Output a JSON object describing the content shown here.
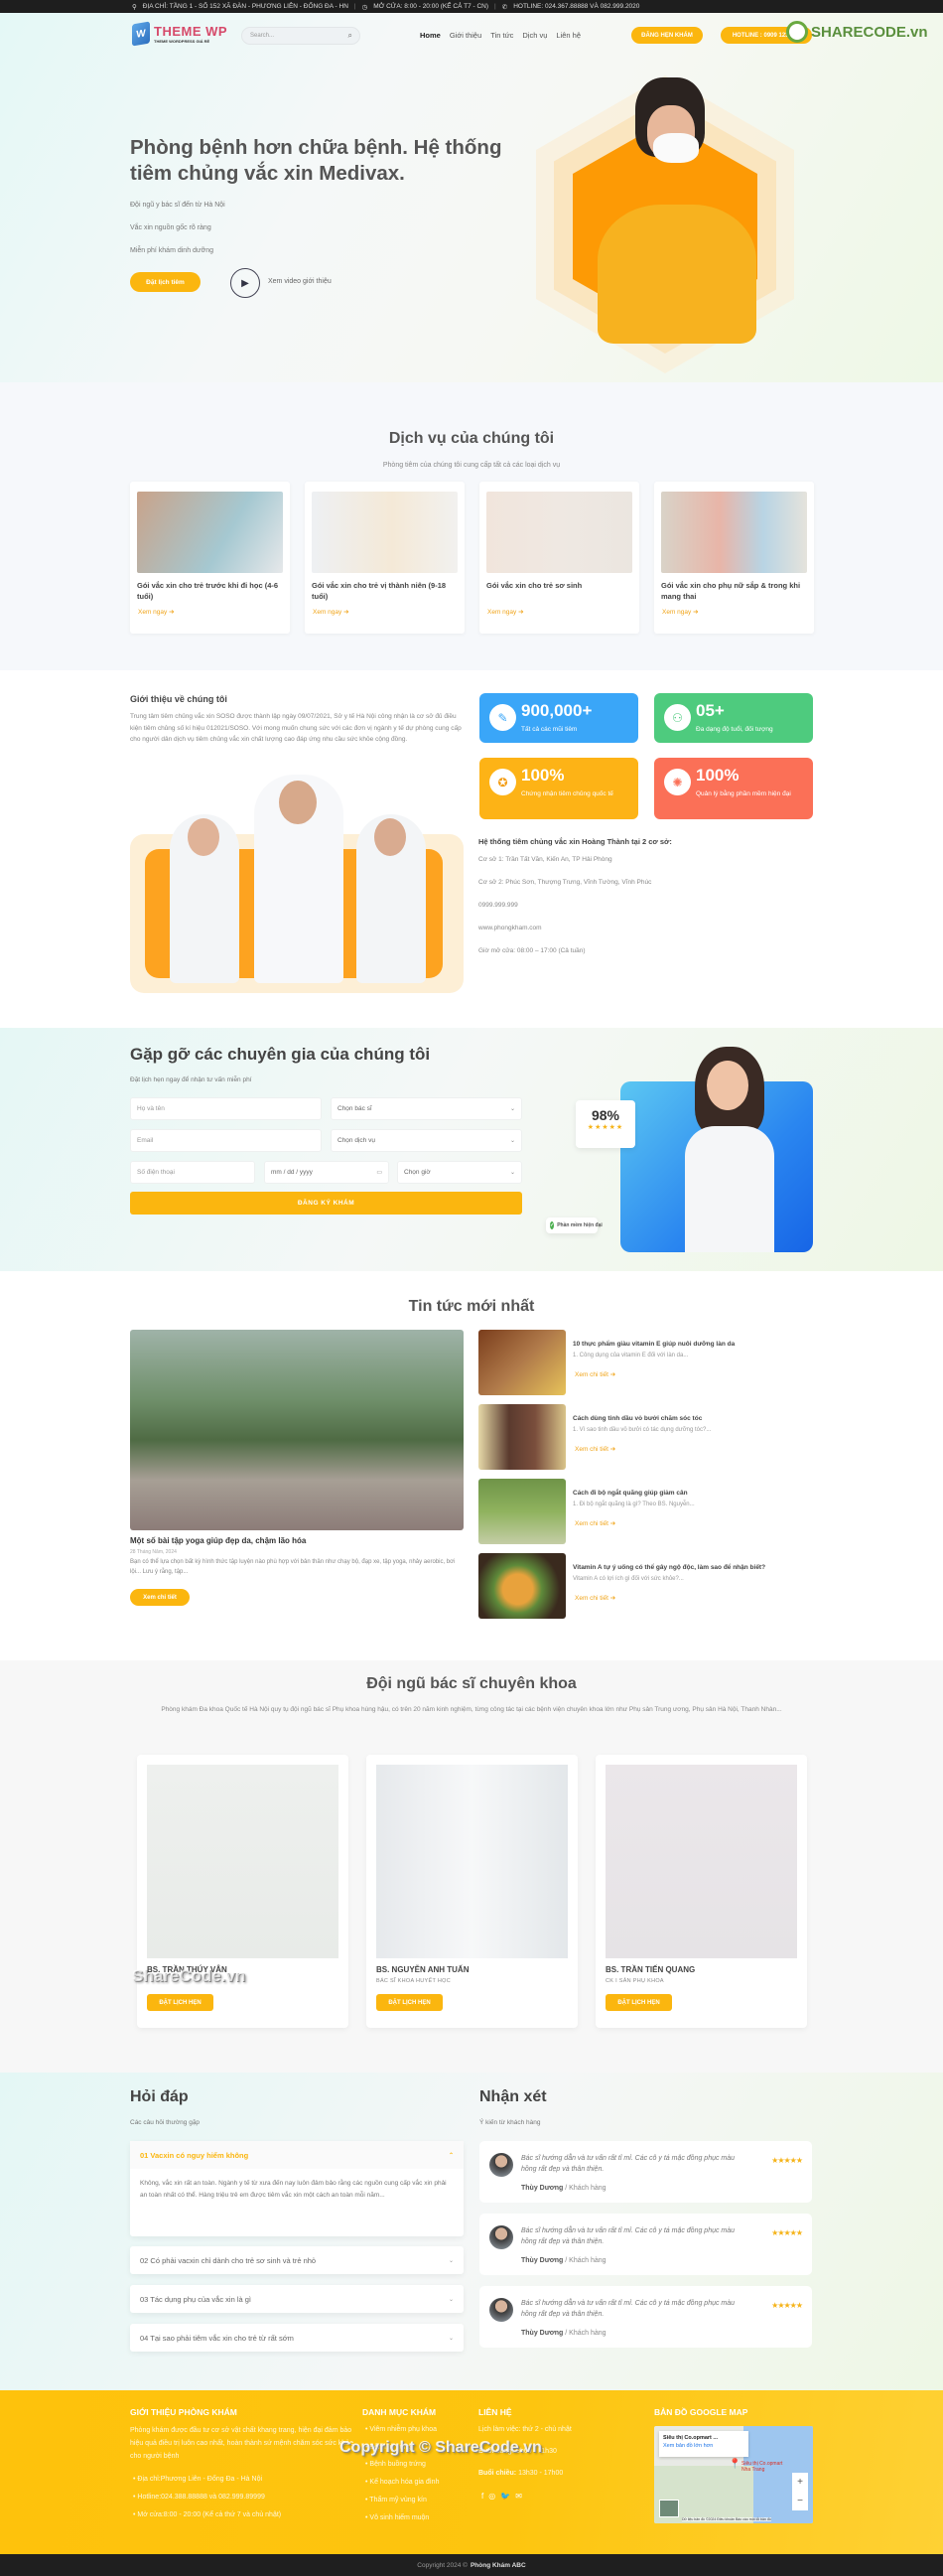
{
  "topbar": {
    "address": "ĐỊA CHỈ: TẦNG 1 - SỐ 152 XÃ ĐÀN - PHƯƠNG LIÊN - ĐỐNG ĐA - HN",
    "hours": "MỞ CỬA: 8:00 - 20:00 (KỂ CẢ T7 - CN)",
    "hotline": "HOTLINE: 024.367.88888 VÀ 082.999.2020"
  },
  "header": {
    "logo_title": "THEME WP",
    "logo_sub": "THEME WORDPRESS GIÁ RẺ",
    "search_placeholder": "Search...",
    "nav": [
      "Home",
      "Giới thiệu",
      "Tin tức",
      "Dịch vụ",
      "Liên hệ"
    ],
    "book_button": "ĐĂNG HẸN KHÁM",
    "hotline_button": "HOTLINE : 0909 123 456",
    "watermark": "SHARECODE.vn"
  },
  "hero": {
    "title": "Phòng bệnh hơn chữa bệnh. Hệ thống tiêm chủng vắc xin Medivax.",
    "features": [
      "Đội ngũ y bác sĩ đến từ Hà Nội",
      "Vắc xin nguồn gốc rõ ràng",
      "Miễn phí khám dinh dưỡng"
    ],
    "cta": "Đặt lịch tiêm",
    "video_label": "Xem video giới thiệu"
  },
  "services": {
    "title": "Dịch vụ của chúng tôi",
    "subtitle": "Phòng tiêm của chúng tôi cung cấp tất cả các loại dịch vụ",
    "items": [
      {
        "title": "Gói vắc xin cho trẻ trước khi đi học (4-6 tuổi)",
        "link": "Xem ngay"
      },
      {
        "title": "Gói vắc xin cho trẻ vị thành niên (9-18 tuổi)",
        "link": "Xem ngay"
      },
      {
        "title": "Gói vắc xin cho trẻ sơ sinh",
        "link": "Xem ngay"
      },
      {
        "title": "Gói vắc xin cho phụ nữ sắp & trong khi mang thai",
        "link": "Xem ngay"
      }
    ]
  },
  "about": {
    "title": "Giới thiệu về chúng tôi",
    "text": "Trung tâm tiêm chủng vắc xin SOSO được thành lập ngày 09/07/2021, Sở y tế Hà Nội công nhận là cơ sở đủ điều kiện tiêm chủng số kí hiệu 012021/SOSO. Với mong muốn chung sức với các đơn vị ngành y tế dự phòng cung cấp cho người dân dịch vụ tiêm chủng vắc xin chất lượng cao đáp ứng nhu cầu sức khỏe cộng đồng.",
    "stats": [
      {
        "number": "900,000+",
        "label": "Tất cả các mũi tiêm",
        "icon": "syringe-icon",
        "color": "#3aa6f8"
      },
      {
        "number": "05+",
        "label": "Đa dạng độ tuổi, đối tượng",
        "icon": "family-icon",
        "color": "#4ecb7e"
      },
      {
        "number": "100%",
        "label": "Chứng nhận tiêm chủng quốc tế",
        "icon": "award-icon",
        "color": "#fdb316"
      },
      {
        "number": "100%",
        "label": "Quản lý bằng phần mềm hiện đại",
        "icon": "lightbulb-icon",
        "color": "#fb7057"
      }
    ],
    "system_title": "Hệ thống tiêm chủng vắc xin Hoàng Thành tại 2 cơ sở:",
    "system_lines": [
      "Cơ sở 1: Trần Tất Văn, Kiến An, TP Hải Phòng",
      "Cơ sở 2: Phúc Sơn, Thượng Trưng, Vĩnh Tường, Vĩnh Phúc",
      "0999.999.999",
      "www.phongkham.com",
      "Giờ mở cửa: 08:00 – 17:00 (Cả tuần)"
    ]
  },
  "experts": {
    "title": "Gặp gỡ các chuyên gia của chúng tôi",
    "subtitle": "Đặt lịch hẹn ngay để nhận tư vấn miễn phí",
    "form": {
      "name_placeholder": "Họ và tên",
      "doctor_select": "Chọn bác sĩ",
      "email_placeholder": "Email",
      "service_select": "Chọn dịch vụ",
      "phone_placeholder": "Số điện thoại",
      "date_placeholder": "mm / dd / yyyy",
      "time_select": "Chọn giờ",
      "submit": "ĐĂNG KÝ KHÁM"
    },
    "rating_percent": "98%",
    "rating_stars": 5,
    "badge": "Phần mềm hiện đại"
  },
  "news": {
    "title": "Tin tức mới nhất",
    "featured": {
      "title": "Một số bài tập yoga giúp đẹp da, chậm lão hóa",
      "date": "28 Tháng Năm, 2024",
      "excerpt": "Bạn có thể lựa chọn bất kỳ hình thức tập luyện nào phù hợp với bản thân như chạy bộ, đạp xe, tập yoga, nhảy aerobic, bơi lội... Lưu ý rằng, tập...",
      "button": "Xem chi tiết"
    },
    "items": [
      {
        "title": "10 thực phẩm giàu vitamin E giúp nuôi dưỡng làn da",
        "excerpt": "1. Công dụng của vitamin E đối với làn da...",
        "link": "Xem chi tiết"
      },
      {
        "title": "Cách dùng tinh dầu vỏ bưởi chăm sóc tóc",
        "excerpt": "1. Vì sao tinh dầu vỏ bưởi có tác dụng dưỡng tóc?...",
        "link": "Xem chi tiết"
      },
      {
        "title": "Cách đi bộ ngắt quãng giúp giảm cân",
        "excerpt": "1. Đi bộ ngắt quãng là gì? Theo BS. Nguyễn...",
        "link": "Xem chi tiết"
      },
      {
        "title": "Vitamin A tự ý uống có thể gây ngộ độc, làm sao để nhận biết?",
        "excerpt": "Vitamin A có lợi ích gì đối với sức khỏe?...",
        "link": "Xem chi tiết"
      }
    ]
  },
  "doctors": {
    "title": "Đội ngũ bác sĩ chuyên khoa",
    "subtitle": "Phòng khám Đa khoa Quốc tế Hà Nội quy tụ đội ngũ bác sĩ Phụ khoa hùng hậu, có trên 20 năm kinh nghiệm, từng công tác tại các bệnh viện chuyên khoa lớn như Phụ sản Trung ương, Phụ sản Hà Nội, Thanh Nhàn...",
    "items": [
      {
        "name": "BS. TRẦN THÚY VÂN",
        "role": "",
        "button": "ĐẶT LỊCH HẸN"
      },
      {
        "name": "BS. NGUYỄN ANH TUẤN",
        "role": "BÁC SĨ KHOA HUYẾT HỌC",
        "button": "ĐẶT LỊCH HẸN"
      },
      {
        "name": "BS. TRẦN TIẾN QUANG",
        "role": "CK I SẢN PHỤ KHOA",
        "button": "ĐẶT LỊCH HẸN"
      }
    ],
    "watermark": "ShareCode.vn"
  },
  "faq": {
    "title": "Hỏi đáp",
    "subtitle": "Các câu hỏi thường gặp",
    "items": [
      {
        "q": "01 Vacxin có nguy hiểm không",
        "a": "Không, vắc xin rất an toàn. Ngành y tế từ xưa đến nay luôn đảm bảo rằng các nguồn cung cấp vắc xin phải an toàn nhất có thể. Hàng triệu trẻ em được tiêm vắc xin một cách an toàn mỗi năm...",
        "open": true
      },
      {
        "q": "02 Có phải vacxin chỉ dành cho trẻ sơ sinh và trẻ nhỏ",
        "open": false
      },
      {
        "q": "03 Tác dụng phụ của vắc xin là gì",
        "open": false
      },
      {
        "q": "04 Tại sao phải tiêm vắc xin cho trẻ từ rất sớm",
        "open": false
      }
    ]
  },
  "reviews": {
    "title": "Nhận xét",
    "subtitle": "Ý kiến từ khách hàng",
    "items": [
      {
        "text": "Bác sĩ hướng dẫn và tư vấn rất tỉ mỉ. Các cô y tá mặc đồng phục màu hồng rất đẹp và thân thiện.",
        "author": "Thùy Dương",
        "role": "Khách hàng",
        "stars": 5
      },
      {
        "text": "Bác sĩ hướng dẫn và tư vấn rất tỉ mỉ. Các cô y tá mặc đồng phục màu hồng rất đẹp và thân thiện.",
        "author": "Thùy Dương",
        "role": "Khách hàng",
        "stars": 5
      },
      {
        "text": "Bác sĩ hướng dẫn và tư vấn rất tỉ mỉ. Các cô y tá mặc đồng phục màu hồng rất đẹp và thân thiện.",
        "author": "Thùy Dương",
        "role": "Khách hàng",
        "stars": 5
      }
    ]
  },
  "footer": {
    "about_title": "GIỚI THIỆU PHÒNG KHÁM",
    "about_text": "Phòng khám được đầu tư cơ sở vật chất khang trang, hiện đại đảm bảo hiệu quả điều trị luôn cao nhất, hoàn thành sứ mệnh chăm sóc sức khỏe cho người bệnh",
    "about_items": [
      "Địa chỉ:Phương Liên - Đống Đa - Hà Nội",
      "Hotline:024.388.88888 và 082.999.89999",
      "Mở cửa:8:00 - 20:00 (Kể cả thứ 7 và chủ nhật)"
    ],
    "category_title": "DANH MỤC KHÁM",
    "categories": [
      "Viêm nhiễm phụ khoa",
      "Bệnh tử cung",
      "Bệnh buồng trứng",
      "Kế hoạch hóa gia đình",
      "Thẩm mỹ vùng kín",
      "Vô sinh hiếm muộn"
    ],
    "contact_title": "LIÊN HỆ",
    "contact_schedule": "Lịch làm việc: thứ 2 - chủ nhật",
    "morning_label": "Buổi sáng:",
    "morning_hours": "8h00 - 11h30",
    "afternoon_label": "Buổi chiều:",
    "afternoon_hours": "13h30 - 17h00",
    "social_icons": [
      "facebook-icon",
      "instagram-icon",
      "twitter-icon",
      "email-icon"
    ],
    "map_title": "BẢN ĐỒ GOOGLE MAP",
    "map_place": "Siêu thị Co.opmart ...",
    "map_link": "Xem bản đồ lớn hơn",
    "map_pin_label": "Siêu thị Co.opmart Nha Trang",
    "map_footer": "Dữ liệu bản đồ ©2024   Điều khoản   Báo cáo một lỗi bản đồ",
    "watermark_copyright": "Copyright © ShareCode.vn",
    "watermark_sharecode": "ShareCode.vn",
    "copyright_prefix": "Copyright 2024 ©",
    "copyright_brand": "Phòng Khám ABC"
  },
  "colors": {
    "accent": "#fbb60f",
    "dark": "#1e1e1e",
    "link": "#f0a419"
  }
}
